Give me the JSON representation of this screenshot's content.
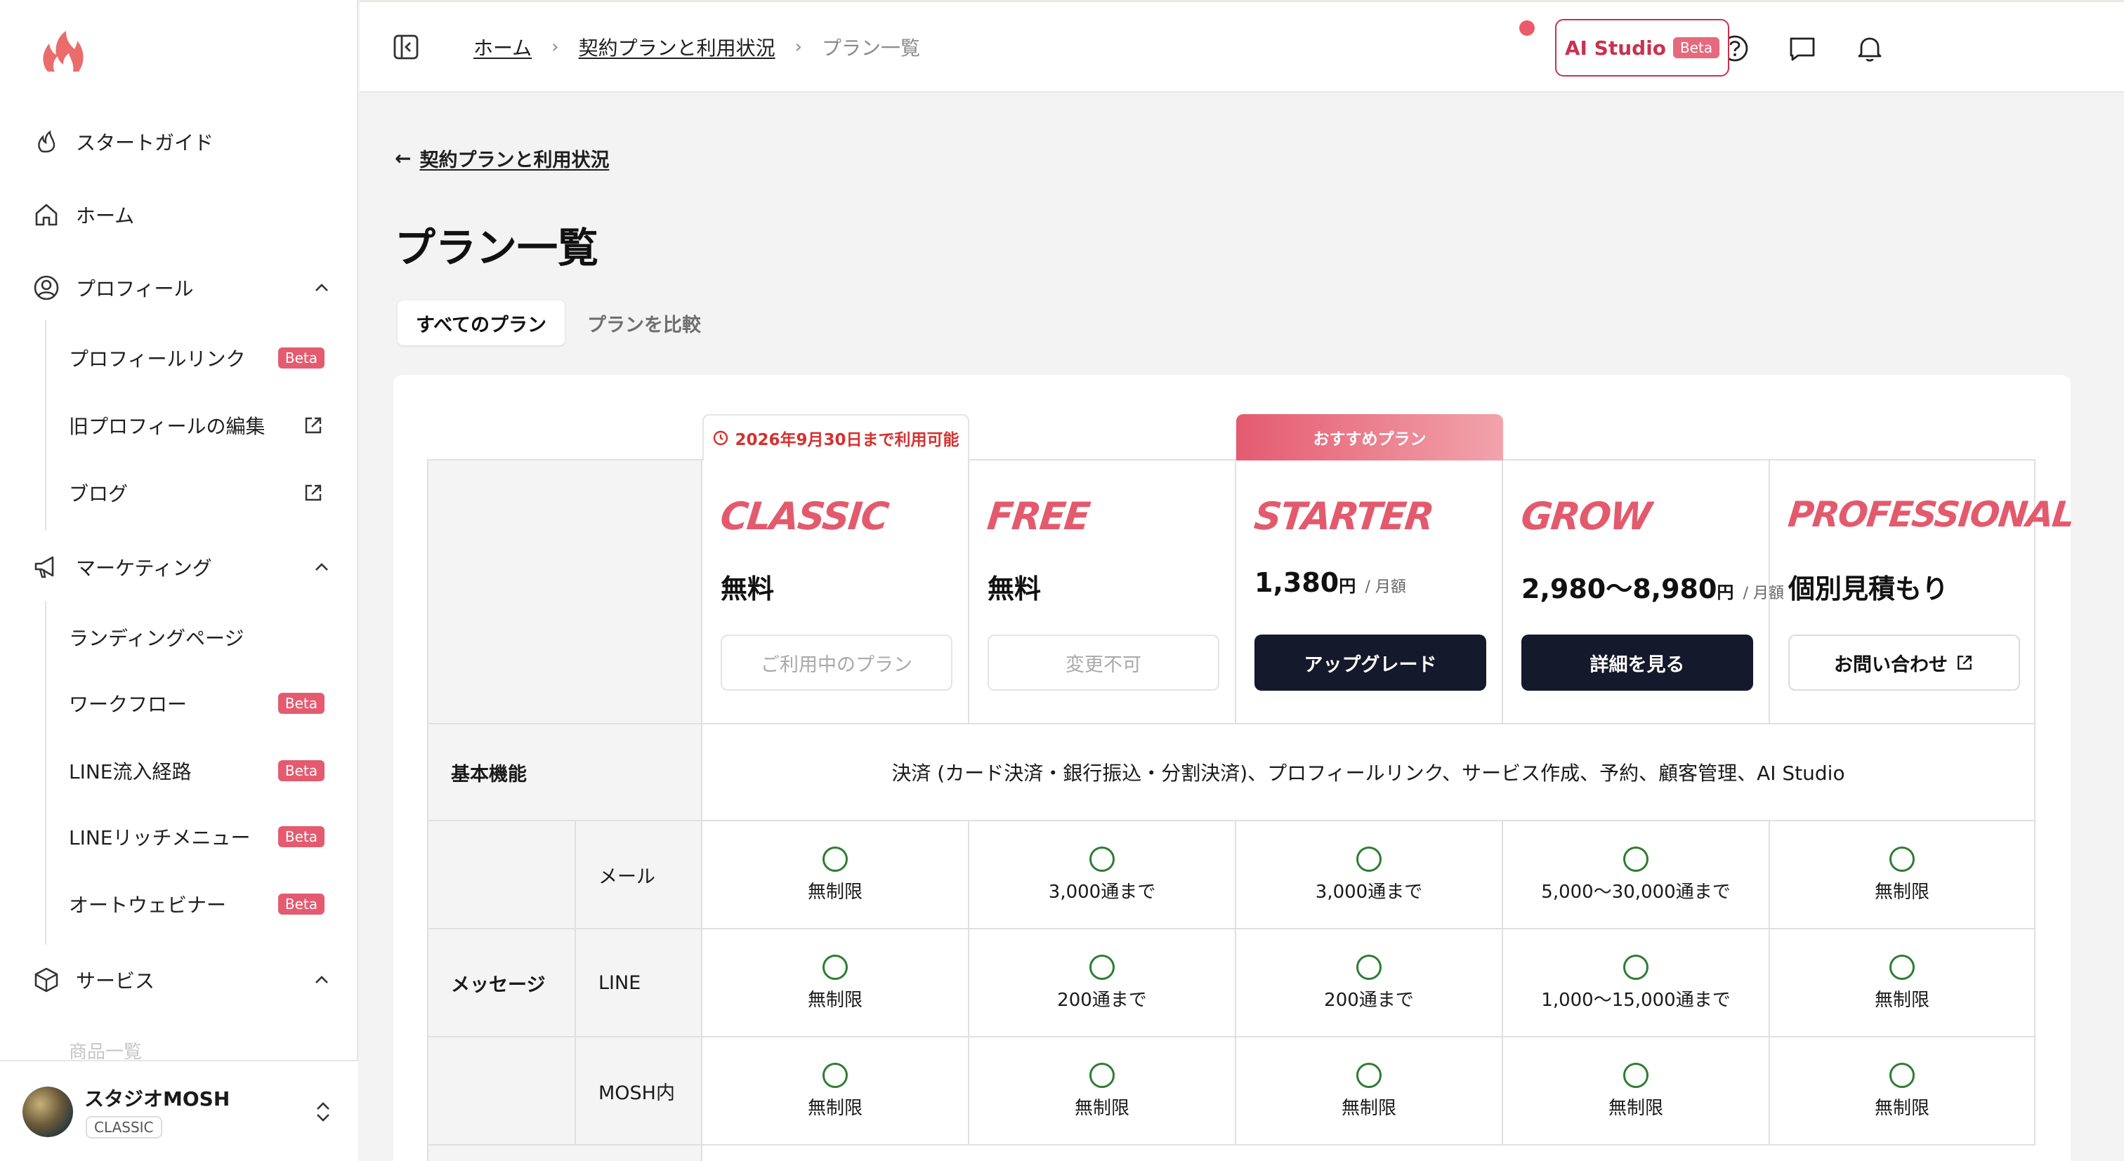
{
  "sidebar": {
    "items": [
      {
        "label": "スタートガイド"
      },
      {
        "label": "ホーム"
      },
      {
        "label": "プロフィール"
      },
      {
        "label": "マーケティング"
      },
      {
        "label": "サービス"
      }
    ],
    "profile_sub": [
      {
        "label": "プロフィールリンク",
        "badge": "Beta"
      },
      {
        "label": "旧プロフィールの編集"
      },
      {
        "label": "ブログ"
      }
    ],
    "marketing_sub": [
      {
        "label": "ランディングページ"
      },
      {
        "label": "ワークフロー",
        "badge": "Beta"
      },
      {
        "label": "LINE流入経路",
        "badge": "Beta"
      },
      {
        "label": "LINEリッチメニュー",
        "badge": "Beta"
      },
      {
        "label": "オートウェビナー",
        "badge": "Beta"
      }
    ],
    "faded_item": "商品一覧",
    "footer": {
      "name": "スタジオMOSH",
      "plan": "CLASSIC"
    }
  },
  "header": {
    "breadcrumb": [
      "ホーム",
      "契約プランと利用状況",
      "プラン一覧"
    ],
    "separator": "›",
    "ai_studio_label": "AI Studio",
    "ai_studio_badge": "Beta"
  },
  "main": {
    "back_link": "契約プランと利用状況",
    "back_arrow": "←",
    "title": "プラン一覧",
    "tabs": [
      {
        "label": "すべてのプラン",
        "active": true
      },
      {
        "label": "プランを比較",
        "active": false
      }
    ]
  },
  "plans": [
    {
      "name": "CLASSIC",
      "price": "無料",
      "button": "ご利用中のプラン",
      "tag": "2026年9月30日まで利用可能"
    },
    {
      "name": "FREE",
      "price": "無料",
      "button": "変更不可"
    },
    {
      "name": "STARTER",
      "price": "1,380",
      "unit": "円",
      "per": "/ 月額",
      "button": "アップグレード",
      "tag": "おすすめプラン"
    },
    {
      "name": "GROW",
      "price": "2,980〜8,980",
      "unit": "円",
      "per": "/ 月額",
      "button": "詳細を見る"
    },
    {
      "name": "PROFESSIONAL",
      "price": "個別見積もり",
      "button": "お問い合わせ"
    }
  ],
  "features": {
    "basic_label": "基本機能",
    "basic_value": "決済 (カード決済・銀行振込・分割決済)、プロフィールリンク、サービス作成、予約、顧客管理、AI Studio",
    "message_label": "メッセージ",
    "rows": [
      {
        "label": "メール",
        "values": [
          "無制限",
          "3,000通まで",
          "3,000通まで",
          "5,000〜30,000通まで",
          "無制限"
        ]
      },
      {
        "label": "LINE",
        "values": [
          "無制限",
          "200通まで",
          "200通まで",
          "1,000〜15,000通まで",
          "無制限"
        ]
      },
      {
        "label": "MOSH内",
        "values": [
          "無制限",
          "無制限",
          "無制限",
          "無制限",
          "無制限"
        ]
      }
    ]
  },
  "colors": {
    "accent": "#e35a6d",
    "primary_button": "#14192b",
    "warn": "#d6312f",
    "check": "#2e7d32"
  }
}
